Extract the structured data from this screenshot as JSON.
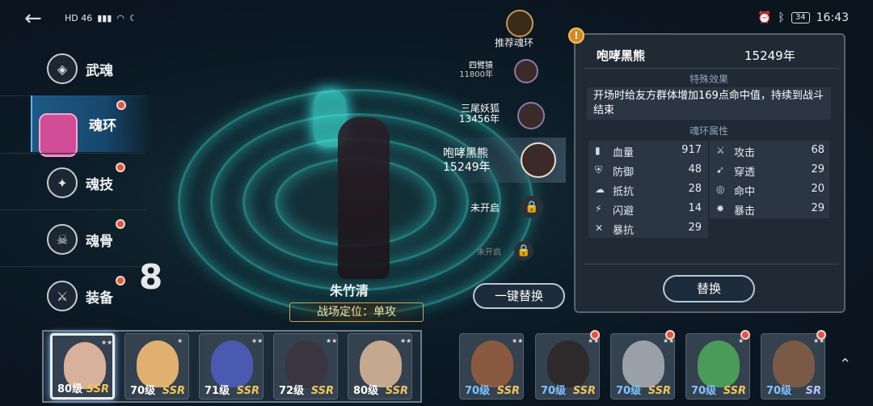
{
  "status": {
    "network": "HD 46",
    "right_time": "16:43",
    "battery": "34"
  },
  "menu": [
    {
      "label": "武魂",
      "icon": "spirit-icon"
    },
    {
      "label": "魂环",
      "icon": "ring-icon"
    },
    {
      "label": "魂技",
      "icon": "skill-icon"
    },
    {
      "label": "魂骨",
      "icon": "bone-icon"
    },
    {
      "label": "装备",
      "icon": "equip-icon"
    }
  ],
  "equip_count": "8",
  "recommend": {
    "label": "推荐魂环"
  },
  "rings": [
    {
      "name": "四臂猿",
      "years": "11800年"
    },
    {
      "name": "三尾妖狐",
      "years": "13456年"
    },
    {
      "name": "咆哮黑熊",
      "years": "15249年"
    },
    {
      "name": "未开启"
    },
    {
      "name": "未开启"
    }
  ],
  "character": {
    "name": "朱竹清",
    "role": "战场定位：单攻"
  },
  "one_click": "一键替换",
  "panel": {
    "title": "咆哮黑熊",
    "years": "15249年",
    "special_title": "特殊效果",
    "special_text": "开场时给友方群体增加169点命中值，持续到战斗结束",
    "attr_title": "魂环属性",
    "attrs_left": [
      {
        "name": "血量",
        "value": "917",
        "icon": "blood-icon"
      },
      {
        "name": "防御",
        "value": "48",
        "icon": "shield-icon"
      },
      {
        "name": "抵抗",
        "value": "28",
        "icon": "resist-icon"
      },
      {
        "name": "闪避",
        "value": "14",
        "icon": "dodge-icon"
      },
      {
        "name": "暴抗",
        "value": "29",
        "icon": "crit-resist-icon"
      }
    ],
    "attrs_right": [
      {
        "name": "攻击",
        "value": "68",
        "icon": "attack-icon"
      },
      {
        "name": "穿透",
        "value": "29",
        "icon": "pierce-icon"
      },
      {
        "name": "命中",
        "value": "20",
        "icon": "hit-icon"
      },
      {
        "name": "暴击",
        "value": "29",
        "icon": "crit-icon"
      }
    ],
    "swap": "替换"
  },
  "team": [
    {
      "level": "80级",
      "rarity": "SSR"
    },
    {
      "level": "70级",
      "rarity": "SSR"
    },
    {
      "level": "71级",
      "rarity": "SSR"
    },
    {
      "level": "72级",
      "rarity": "SSR"
    },
    {
      "level": "80级",
      "rarity": "SSR"
    }
  ],
  "bench": [
    {
      "level": "70级",
      "rarity": "SSR"
    },
    {
      "level": "70级",
      "rarity": "SSR"
    },
    {
      "level": "70级",
      "rarity": "SSR"
    },
    {
      "level": "70级",
      "rarity": "SSR"
    },
    {
      "level": "70级",
      "rarity": "SR"
    }
  ]
}
